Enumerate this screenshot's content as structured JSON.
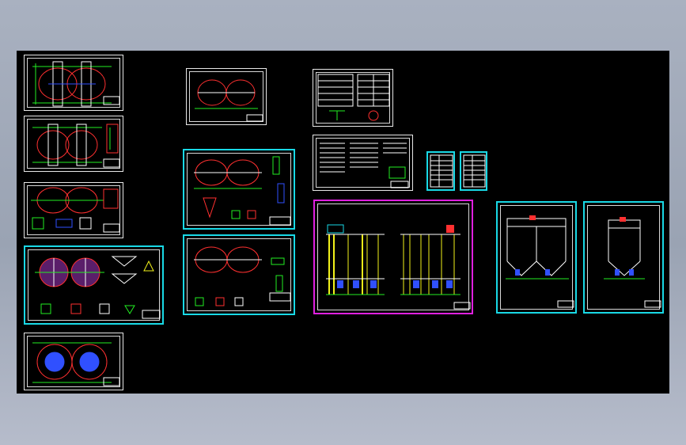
{
  "canvas": {
    "background": "#000000"
  },
  "colors": {
    "frame": "#e8e8e8",
    "cyan": "#19d9e6",
    "magenta": "#e020e0",
    "red": "#ff3030",
    "green": "#22ee22",
    "yellow": "#f2f21a",
    "blue": "#3050ff",
    "white": "#ffffff"
  },
  "sheets": [
    {
      "id": "plan-1",
      "kind": "twin-tank-plan"
    },
    {
      "id": "plan-2",
      "kind": "twin-tank-plan"
    },
    {
      "id": "plan-3",
      "kind": "twin-tank-plan"
    },
    {
      "id": "plan-4",
      "kind": "twin-tank-detail"
    },
    {
      "id": "plan-5",
      "kind": "twin-circle-plan"
    },
    {
      "id": "section-top",
      "kind": "tank-section"
    },
    {
      "id": "section-mid",
      "kind": "tank-section-detail"
    },
    {
      "id": "section-low",
      "kind": "tank-section-detail"
    },
    {
      "id": "table-sheet",
      "kind": "tables"
    },
    {
      "id": "notes-sheet",
      "kind": "notes"
    },
    {
      "id": "mini-table-1",
      "kind": "mini-table"
    },
    {
      "id": "mini-table-2",
      "kind": "mini-table"
    },
    {
      "id": "elevation-large",
      "kind": "elevation"
    },
    {
      "id": "elevation-right-1",
      "kind": "elevation"
    },
    {
      "id": "elevation-right-2",
      "kind": "elevation"
    }
  ]
}
